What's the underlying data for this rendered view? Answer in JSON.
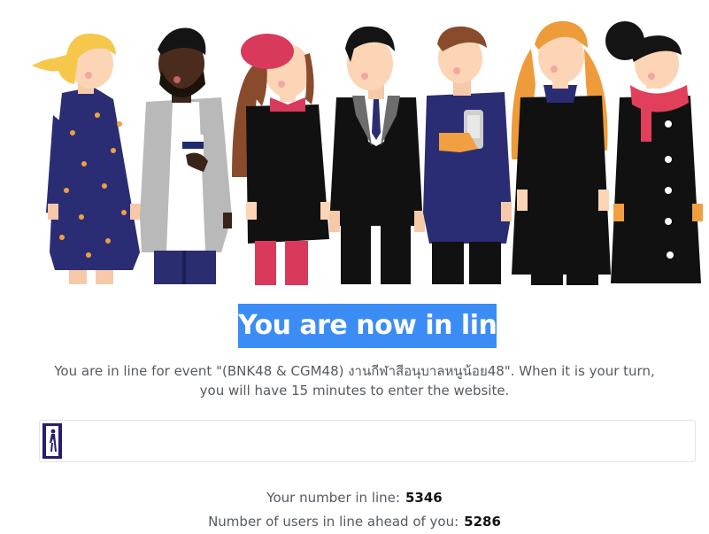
{
  "queue": {
    "headline": "You are now in line",
    "message_line1": "You are in line for event \"(BNK48 & CGM48) งานกีฬาสีอนุบาลหนูน้อย48\". When it is your turn,",
    "message_line2": "you will have 15 minutes to enter the website.",
    "progress_percent": 3,
    "number_label": "Your number in line:",
    "number_value": "5346",
    "ahead_label": "Number of users in line ahead of you:",
    "ahead_value": "5286"
  },
  "icons": {
    "illustration": "queue-of-people-illustration",
    "progress_marker": "walking-person-icon"
  },
  "colors": {
    "headline_bg": "#3b8cf5",
    "headline_text": "#ffffff",
    "progress_fill": "#2a1b6e",
    "body_text": "#555b61",
    "value_text": "#111111"
  }
}
